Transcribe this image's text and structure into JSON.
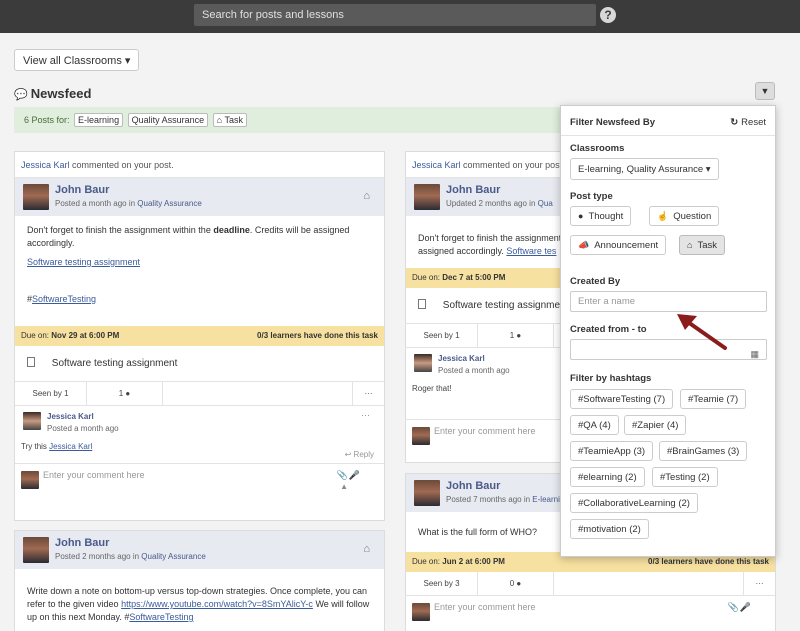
{
  "topbar": {
    "search_placeholder": "Search for posts and lessons",
    "help": "?"
  },
  "classroom_select": {
    "label": "View all Classrooms",
    "chevron": "▾"
  },
  "newsfeed": {
    "title": "Newsfeed",
    "icon": "comments-icon"
  },
  "posts_bar": {
    "count_text": "6 Posts for:",
    "tags": [
      "E-learning",
      "Quality Assurance",
      "Task"
    ]
  },
  "left_post1": {
    "notify_user": "Jessica Karl",
    "notify_text": "commented on your post.",
    "author": "John Baur",
    "meta_prefix": "Posted a month ago in",
    "meta_class": "Quality Assurance",
    "body_pre": "Don't forget to finish the assignment within the",
    "body_bold": "deadline",
    "body_post": ". Credits will be assigned accordingly.",
    "link": "Software testing assignment",
    "hashtag_prefix": "#",
    "hashtag": "SoftwareTesting",
    "due_label": "Due on:",
    "due_value": "Nov 29 at 6:00 PM",
    "progress": "0/3 learners have done this task",
    "task": "Software testing assignment",
    "seen": "Seen by 1",
    "comments": "1",
    "more": "···",
    "comment_name": "Jessica Karl",
    "comment_time": "Posted a month ago",
    "comment_pre": "Try this",
    "comment_link": "Jessica Karl",
    "reply": "Reply",
    "input_placeholder": "Enter your comment here"
  },
  "left_post2": {
    "author": "John Baur",
    "meta_prefix": "Posted 2 months ago in",
    "meta_class": "Quality Assurance",
    "body": "Write down a note on bottom-up versus top-down strategies. Once complete, you can refer to the given video",
    "link": "https://www.youtube.com/watch?v=8SmYAlicY-c",
    "body_post": "We will follow up on this next Monday.",
    "hashtag": "SoftwareTesting"
  },
  "right_post1": {
    "notify_user": "Jessica Karl",
    "notify_text": "commented on your post.",
    "author": "John Baur",
    "meta_prefix": "Updated 2 months ago in",
    "meta_class": "Qua",
    "body": "Don't forget to finish the assignment within the",
    "body2": "assigned accordingly.",
    "link": "Software tes",
    "due_label": "Due on:",
    "due_value": "Dec 7 at 5:00 PM",
    "task": "Software testing assignment",
    "seen": "Seen by 1",
    "comments": "1",
    "comment_name": "Jessica Karl",
    "comment_time": "Posted a month ago",
    "comment_text": "Roger that!",
    "input_placeholder": "Enter your comment here"
  },
  "right_post2": {
    "author": "John Baur",
    "meta_prefix": "Posted 7 months ago in",
    "meta_class": "E-learnin",
    "body": "What is the full form of WHO?",
    "due_label": "Due on:",
    "due_value": "Jun 2 at 6:00 PM",
    "progress": "0/3 learners have done this task",
    "seen": "Seen by 3",
    "comments": "0",
    "more": "···",
    "input_placeholder": "Enter your comment here"
  },
  "filter": {
    "title": "Filter Newsfeed By",
    "reset": "Reset",
    "classrooms_label": "Classrooms",
    "classrooms_value": "E-learning, Quality Assurance",
    "post_type_label": "Post type",
    "types": [
      "Thought",
      "Question",
      "Announcement",
      "Task"
    ],
    "created_by_label": "Created By",
    "created_by_placeholder": "Enter a name",
    "created_range_label": "Created from - to",
    "hashtags_label": "Filter by hashtags",
    "hashtags": [
      "#SoftwareTesting (7)",
      "#Teamie (7)",
      "#QA (4)",
      "#Zapier (4)",
      "#TeamieApp (3)",
      "#BrainGames (3)",
      "#elearning (2)",
      "#Testing (2)",
      "#CollaborativeLearning (2)",
      "#motivation (2)"
    ]
  },
  "colors": {
    "topbar": "#3b3b3b",
    "accent_name": "#4a5a8a",
    "due_bar": "#f7e1a0",
    "posts_bar": "#dfeedd",
    "arrow": "#8b1c1c"
  }
}
